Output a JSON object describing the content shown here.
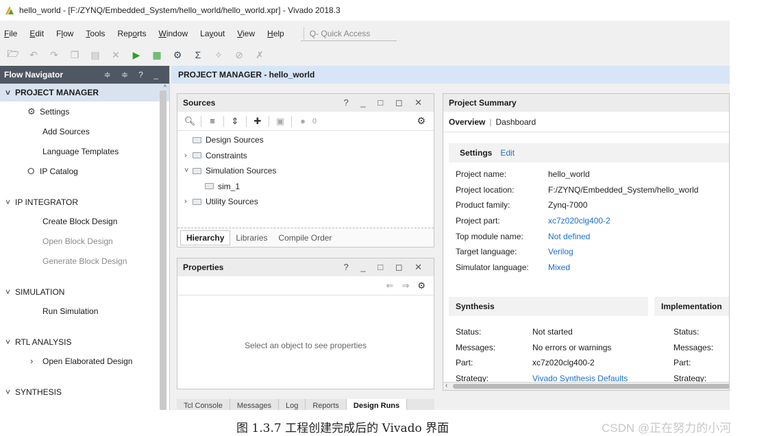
{
  "window": {
    "title": "hello_world - [F:/ZYNQ/Embedded_System/hello_world/hello_world.xpr] - Vivado 2018.3"
  },
  "menu": {
    "items": [
      {
        "pre": "",
        "ul": "F",
        "post": "ile"
      },
      {
        "pre": "",
        "ul": "E",
        "post": "dit"
      },
      {
        "pre": "F",
        "ul": "l",
        "post": "ow"
      },
      {
        "pre": "",
        "ul": "T",
        "post": "ools"
      },
      {
        "pre": "Rep",
        "ul": "o",
        "post": "rts"
      },
      {
        "pre": "",
        "ul": "W",
        "post": "indow"
      },
      {
        "pre": "La",
        "ul": "y",
        "post": "out"
      },
      {
        "pre": "",
        "ul": "V",
        "post": "iew"
      },
      {
        "pre": "",
        "ul": "H",
        "post": "elp"
      }
    ],
    "quick_access_placeholder": "Q- Quick Access"
  },
  "toolbar": {
    "icons": [
      "open-project-icon",
      "undo-icon",
      "redo-icon",
      "copy-icon",
      "paste-icon",
      "delete-icon",
      "run-icon",
      "program-device-icon",
      "settings-icon",
      "sigma-icon",
      "wand-icon",
      "slash-icon",
      "cross-icon"
    ]
  },
  "flow_navigator": {
    "title": "Flow Navigator",
    "header_controls": "≑ ≑ ? _",
    "sections": [
      {
        "label": "PROJECT MANAGER",
        "items": [
          {
            "label": "Settings",
            "icon": "gear-icon"
          },
          {
            "label": "Add Sources"
          },
          {
            "label": "Language Templates"
          },
          {
            "label": "IP Catalog",
            "icon": "ip-catalog-icon"
          }
        ]
      },
      {
        "label": "IP INTEGRATOR",
        "items": [
          {
            "label": "Create Block Design"
          },
          {
            "label": "Open Block Design",
            "disabled": true
          },
          {
            "label": "Generate Block Design",
            "disabled": true
          }
        ]
      },
      {
        "label": "SIMULATION",
        "items": [
          {
            "label": "Run Simulation"
          }
        ]
      },
      {
        "label": "RTL ANALYSIS",
        "items": [
          {
            "label": "Open Elaborated Design",
            "expandable": true
          }
        ]
      },
      {
        "label": "SYNTHESIS",
        "items": []
      }
    ]
  },
  "project_manager_bar": {
    "title": "PROJECT MANAGER - hello_world"
  },
  "sources": {
    "title": "Sources",
    "count": "0",
    "tree": [
      {
        "label": "Design Sources",
        "expandable": false,
        "expanded": false,
        "indent": 0
      },
      {
        "label": "Constraints",
        "expandable": true,
        "expanded": false,
        "indent": 0
      },
      {
        "label": "Simulation Sources",
        "expandable": true,
        "expanded": true,
        "indent": 0
      },
      {
        "label": "sim_1",
        "expandable": false,
        "expanded": false,
        "indent": 1
      },
      {
        "label": "Utility Sources",
        "expandable": true,
        "expanded": false,
        "indent": 0
      }
    ],
    "tabs": [
      "Hierarchy",
      "Libraries",
      "Compile Order"
    ]
  },
  "properties": {
    "title": "Properties",
    "empty_text": "Select an object to see properties"
  },
  "bottom_tabs": [
    "Tcl Console",
    "Messages",
    "Log",
    "Reports",
    "Design Runs"
  ],
  "project_summary": {
    "title": "Project Summary",
    "tabs": [
      "Overview",
      "Dashboard"
    ],
    "settings": {
      "title": "Settings",
      "edit_label": "Edit",
      "rows": [
        {
          "key": "Project name:",
          "value": "hello_world",
          "link": false
        },
        {
          "key": "Project location:",
          "value": "F:/ZYNQ/Embedded_System/hello_world",
          "link": false
        },
        {
          "key": "Product family:",
          "value": "Zynq-7000",
          "link": false
        },
        {
          "key": "Project part:",
          "value": "xc7z020clg400-2",
          "link": true
        },
        {
          "key": "Top module name:",
          "value": "Not defined",
          "link": true
        },
        {
          "key": "Target language:",
          "value": "Verilog",
          "link": true
        },
        {
          "key": "Simulator language:",
          "value": "Mixed",
          "link": true
        }
      ]
    },
    "synthesis": {
      "title": "Synthesis",
      "rows": [
        {
          "key": "Status:",
          "value": "Not started",
          "link": false
        },
        {
          "key": "Messages:",
          "value": "No errors or warnings",
          "link": false
        },
        {
          "key": "Part:",
          "value": "xc7z020clg400-2",
          "link": false
        },
        {
          "key": "Strategy:",
          "value": "Vivado Synthesis Defaults",
          "link": true
        }
      ]
    },
    "implementation": {
      "title": "Implementation",
      "rows": [
        "Status:",
        "Messages:",
        "Part:",
        "Strategy:"
      ]
    }
  },
  "caption": {
    "figure": "图 1.3.7 工程创建完成后的 Vivado 界面",
    "watermark": "CSDN @正在努力的小河"
  }
}
